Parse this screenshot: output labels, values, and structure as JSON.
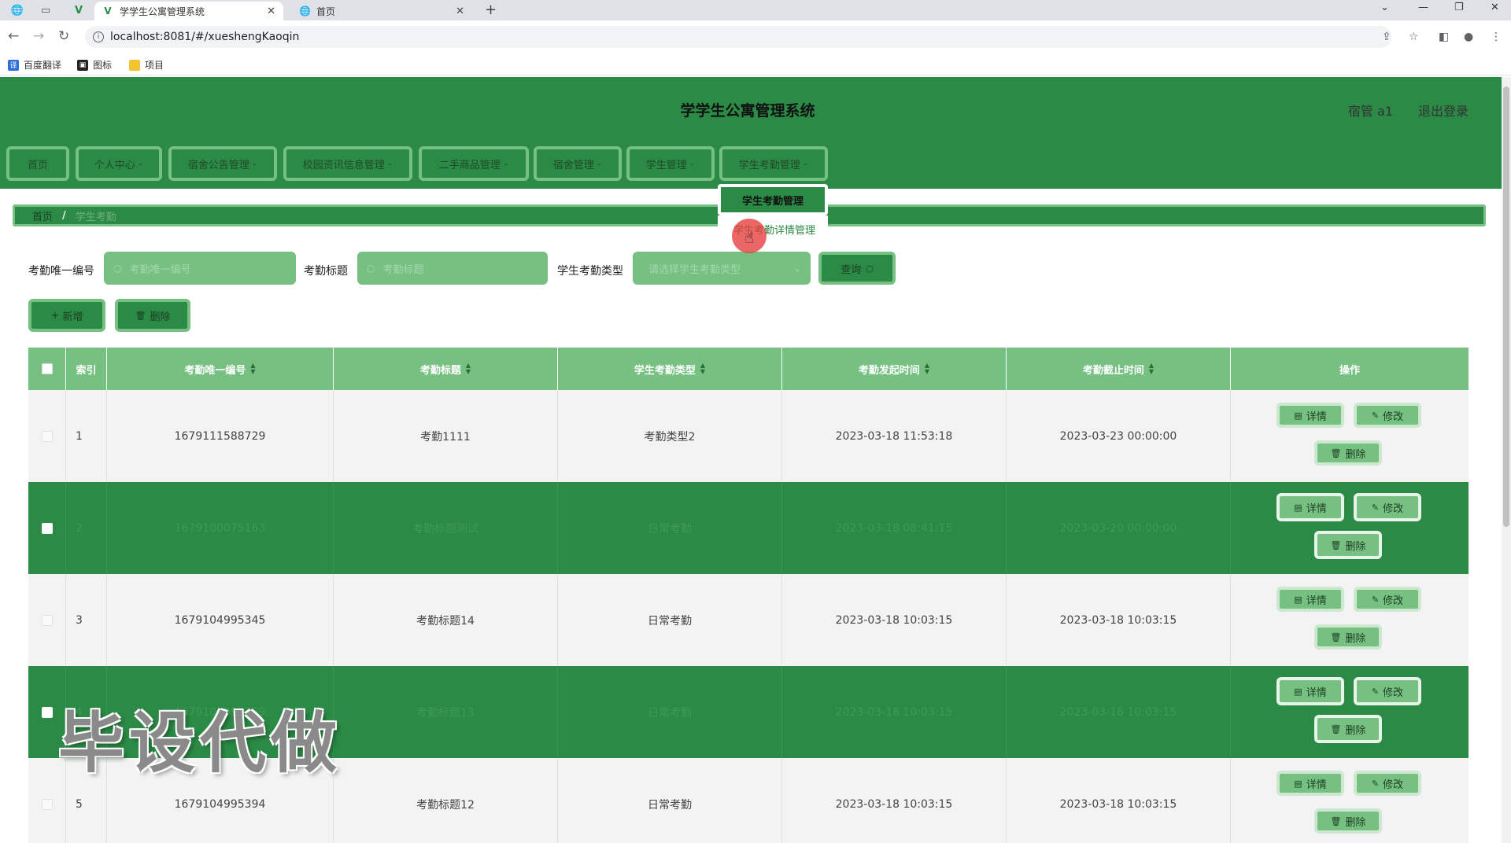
{
  "browser": {
    "tabs": [
      {
        "title": "学学生公寓管理系统",
        "active": true
      },
      {
        "title": "首页",
        "active": false
      }
    ],
    "url": "localhost:8081/#/xueshengKaoqin",
    "bookmarks": [
      "百度翻译",
      "图标",
      "项目"
    ]
  },
  "header": {
    "title": "学学生公寓管理系统",
    "user": "宿管 a1",
    "logout": "退出登录"
  },
  "menu": [
    "首页",
    "个人中心",
    "宿舍公告管理",
    "校园资讯信息管理",
    "二手商品管理",
    "宿舍管理",
    "学生管理",
    "学生考勤管理"
  ],
  "dropdown": {
    "items": [
      "学生考勤管理",
      "学生考勤详情管理"
    ]
  },
  "breadcrumb": {
    "home": "首页",
    "current": "学生考勤"
  },
  "search": {
    "id_label": "考勤唯一编号",
    "id_placeholder": "考勤唯一编号",
    "title_label": "考勤标题",
    "title_placeholder": "考勤标题",
    "type_label": "学生考勤类型",
    "type_placeholder": "请选择学生考勤类型",
    "query_button": "查询"
  },
  "actions": {
    "add": "新增",
    "delete": "删除"
  },
  "table": {
    "headers": [
      "索引",
      "考勤唯一编号",
      "考勤标题",
      "学生考勤类型",
      "考勤发起时间",
      "考勤截止时间",
      "操作"
    ],
    "rows": [
      {
        "index": "1",
        "id": "1679111588729",
        "title": "考勤1111",
        "type": "考勤类型2",
        "start": "2023-03-18 11:53:18",
        "end": "2023-03-23 00:00:00"
      },
      {
        "index": "2",
        "id": "1679100075163",
        "title": "考勤标题测试",
        "type": "日常考勤",
        "start": "2023-03-18 08:41:15",
        "end": "2023-03-20 00:00:00"
      },
      {
        "index": "3",
        "id": "1679104995345",
        "title": "考勤标题14",
        "type": "日常考勤",
        "start": "2023-03-18 10:03:15",
        "end": "2023-03-18 10:03:15"
      },
      {
        "index": "4",
        "id": "1679104995369",
        "title": "考勤标题13",
        "type": "日常考勤",
        "start": "2023-03-18 10:03:15",
        "end": "2023-03-18 10:03:15"
      },
      {
        "index": "5",
        "id": "1679104995394",
        "title": "考勤标题12",
        "type": "日常考勤",
        "start": "2023-03-18 10:03:15",
        "end": "2023-03-18 10:03:15"
      }
    ],
    "op_detail": "详情",
    "op_edit": "修改",
    "op_delete": "删除"
  },
  "watermark": "毕设代做",
  "colors": {
    "primary": "#2b8a45",
    "light": "#76c081"
  }
}
